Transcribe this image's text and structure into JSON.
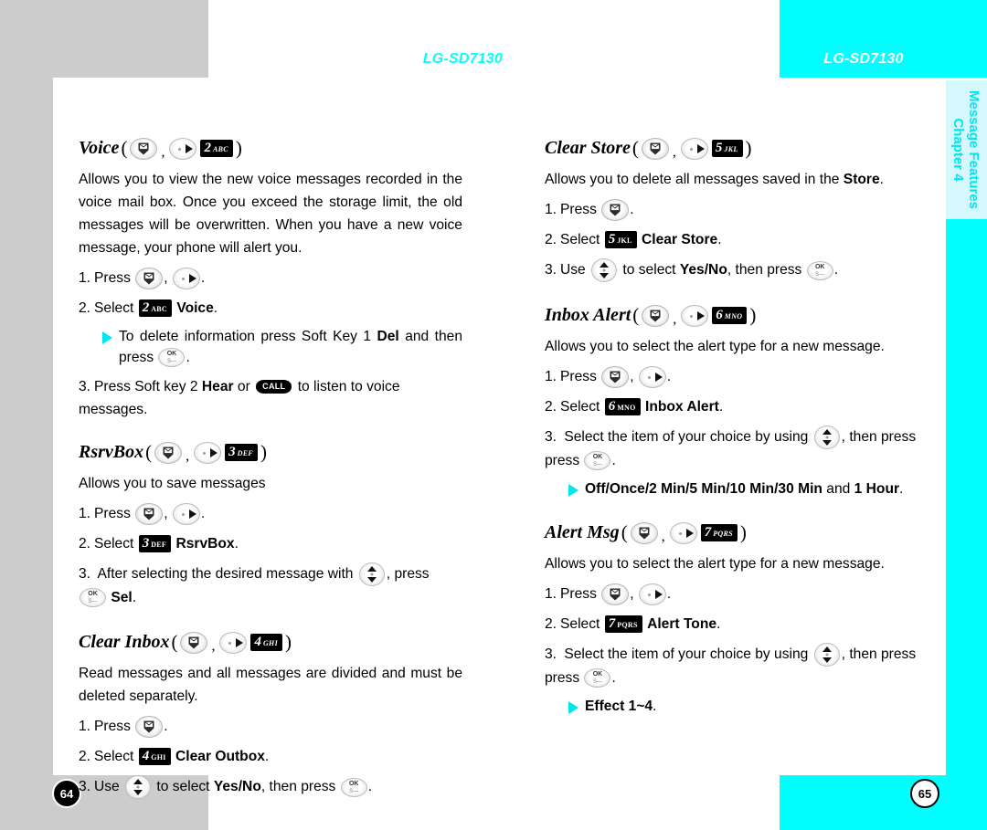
{
  "header": {
    "left_model": "LG-SD7130",
    "right_model": "LG-SD7130"
  },
  "tab": {
    "chapter": "Chapter 4",
    "title": "Message Features"
  },
  "pages": {
    "left": "64",
    "right": "65"
  },
  "keys": {
    "message": "message-key",
    "right": "right-nav-key",
    "updown": "up-down-nav-key",
    "ok_label": "OK",
    "ok_sub": "S—",
    "call": "CALL",
    "k2": {
      "digit": "2",
      "letters": "ABC"
    },
    "k3": {
      "digit": "3",
      "letters": "DEF"
    },
    "k4": {
      "digit": "4",
      "letters": "GHI"
    },
    "k5": {
      "digit": "5",
      "letters": "JKL"
    },
    "k6": {
      "digit": "6",
      "letters": "MNO"
    },
    "k7": {
      "digit": "7",
      "letters": "PQRS"
    }
  },
  "left_column": {
    "voice": {
      "title": "Voice",
      "desc": "Allows you to view the new voice messages recorded in the voice mail box. Once you exceed the storage limit, the old messages will be overwritten. When you have a new voice message, your phone will alert you.",
      "step1_num": "1.",
      "step1_pre": "Press",
      "step1_post": ".",
      "step2_num": "2.",
      "step2_pre": "Select",
      "step2_bold": "Voice",
      "step2_post": ".",
      "bullet_pre": "To delete information press Soft Key 1",
      "bullet_bold": "Del",
      "bullet_mid": "and then press",
      "bullet_post": ".",
      "step3_num": "3.",
      "step3_pre": "Press Soft key 2",
      "step3_bold": "Hear",
      "step3_mid": "or",
      "step3_post": "to listen to voice messages."
    },
    "rsrvbox": {
      "title": "RsrvBox",
      "desc": "Allows you to save messages",
      "step1_num": "1.",
      "step1_pre": "Press",
      "step1_post": ".",
      "step2_num": "2.",
      "step2_pre": "Select",
      "step2_bold": "RsrvBox",
      "step2_post": ".",
      "step3_num": "3.",
      "step3_pre": "After selecting the desired message with",
      "step3_mid": ", press",
      "step3_bold": "Sel",
      "step3_post": "."
    },
    "clear_inbox": {
      "title": "Clear Inbox",
      "desc": "Read messages and all messages are divided and must be deleted separately.",
      "step1_num": "1.",
      "step1_pre": "Press",
      "step1_post": ".",
      "step2_num": "2.",
      "step2_pre": "Select",
      "step2_bold": "Clear Outbox",
      "step2_post": ".",
      "step3_num": "3.",
      "step3_pre": "Use",
      "step3_mid": "to select",
      "step3_bold": "Yes/No",
      "step3_mid2": ", then press",
      "step3_post": "."
    }
  },
  "right_column": {
    "clear_store": {
      "title": "Clear Store",
      "desc_pre": "Allows you to delete all messages saved in the",
      "desc_bold": "Store",
      "desc_post": ".",
      "step1_num": "1.",
      "step1_pre": "Press",
      "step1_post": ".",
      "step2_num": "2.",
      "step2_pre": "Select",
      "step2_bold": "Clear Store",
      "step2_post": ".",
      "step3_num": "3.",
      "step3_pre": "Use",
      "step3_mid": "to select",
      "step3_bold": "Yes/No",
      "step3_mid2": ", then press",
      "step3_post": "."
    },
    "inbox_alert": {
      "title": "Inbox Alert",
      "desc": "Allows you to select the alert type for a new message.",
      "step1_num": "1.",
      "step1_pre": "Press",
      "step1_post": ".",
      "step2_num": "2.",
      "step2_pre": "Select",
      "step2_bold": "Inbox Alert",
      "step2_post": ".",
      "step3_num": "3.",
      "step3_pre": "Select the item of your choice by using",
      "step3_mid": ", then press",
      "step3_post": ".",
      "bullet_bold1": "Off/Once/2 Min/5 Min/10 Min/30 Min",
      "bullet_mid": "and",
      "bullet_bold2": "1 Hour",
      "bullet_post": "."
    },
    "alert_msg": {
      "title": "Alert Msg",
      "desc": "Allows you to select the alert type for a new message.",
      "step1_num": "1.",
      "step1_pre": "Press",
      "step1_post": ".",
      "step2_num": "2.",
      "step2_pre": "Select",
      "step2_bold": "Alert Tone",
      "step2_post": ".",
      "step3_num": "3.",
      "step3_pre": "Select the item of your choice by using",
      "step3_mid": ", then press",
      "step3_post": ".",
      "bullet_bold": "Effect 1~4",
      "bullet_post": "."
    }
  },
  "colors": {
    "cyan": "#00ffff",
    "tab_bg": "#d5f8fd",
    "gray": "#cccccc",
    "bullet": "#00e5ee"
  }
}
